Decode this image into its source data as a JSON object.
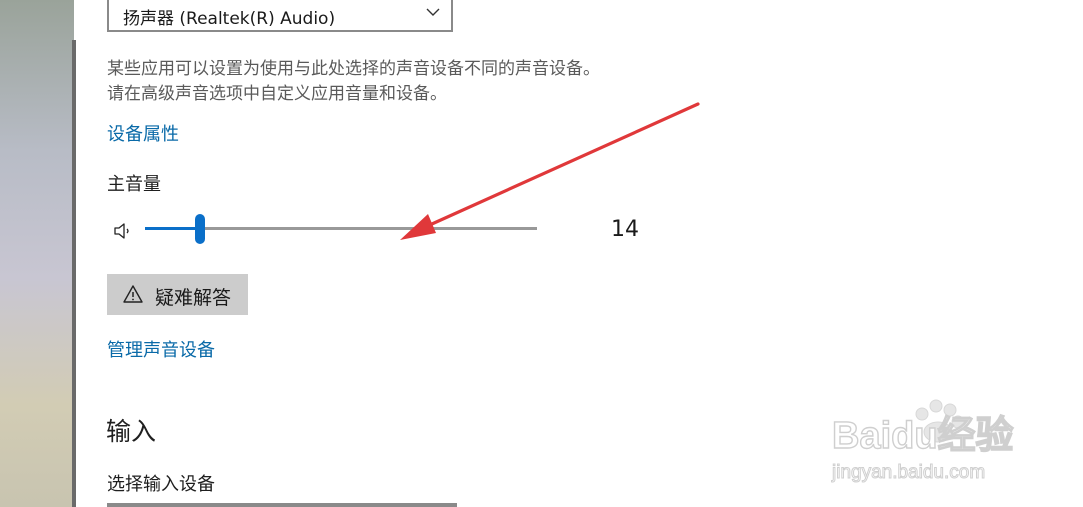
{
  "output": {
    "selected_device": "扬声器 (Realtek(R) Audio)"
  },
  "description": {
    "line1": "某些应用可以设置为使用与此处选择的声音设备不同的声音设备。",
    "line2": "请在高级声音选项中自定义应用音量和设备。"
  },
  "links": {
    "device_properties": "设备属性",
    "manage_sound_devices": "管理声音设备"
  },
  "master_volume": {
    "label": "主音量",
    "value": "14",
    "level_percent": 14
  },
  "troubleshoot_label": "疑难解答",
  "input_section": {
    "title": "输入",
    "choose_device_label": "选择输入设备"
  },
  "watermark": {
    "logo_text": "Baidu经验",
    "url": "jingyan.baidu.com"
  },
  "colors": {
    "accent": "#0a6fc9",
    "link": "#0a6aa8",
    "annotation_arrow": "#e0383a"
  }
}
